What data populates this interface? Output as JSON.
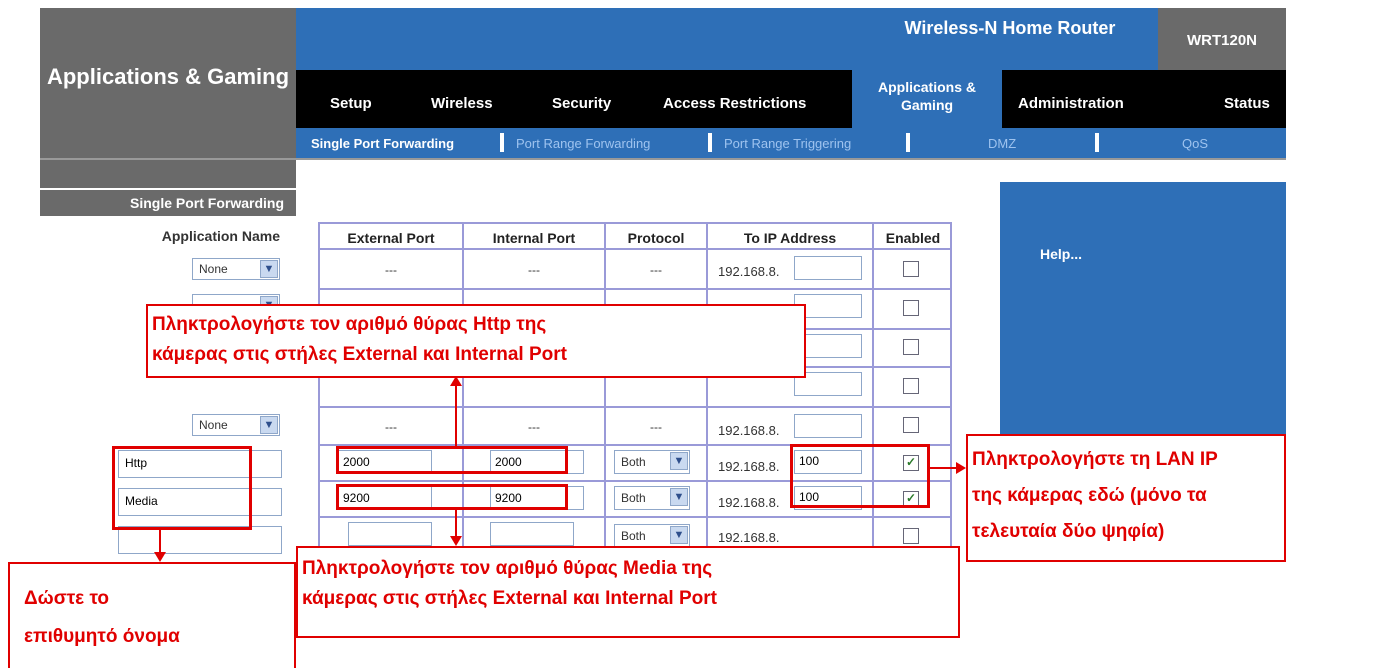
{
  "header": {
    "page_title": "Applications & Gaming",
    "product_name": "Wireless-N Home Router",
    "model": "WRT120N"
  },
  "nav": {
    "tabs": [
      "Setup",
      "Wireless",
      "Security",
      "Access Restrictions",
      "Applications & Gaming",
      "Administration",
      "Status"
    ],
    "active_tab": "Applications & Gaming"
  },
  "subnav": {
    "items": [
      "Single Port Forwarding",
      "Port Range Forwarding",
      "Port Range Triggering",
      "DMZ",
      "QoS"
    ],
    "active": "Single Port Forwarding"
  },
  "left": {
    "section_heading": "Single Port Forwarding",
    "app_name_label": "Application Name",
    "app_select_value": "None",
    "custom_names": [
      "Http",
      "Media",
      ""
    ]
  },
  "table": {
    "headers": [
      "External Port",
      "Internal Port",
      "Protocol",
      "To IP Address",
      "Enabled"
    ],
    "dash": "---",
    "ip_prefix": "192.168.8.",
    "rows": [
      {
        "external": "---",
        "internal": "---",
        "protocol": "---",
        "ip_last": "",
        "enabled": false
      },
      {
        "ip_last": "",
        "enabled": false
      },
      {
        "ip_last": "",
        "enabled": false
      },
      {
        "ip_last": "",
        "enabled": false
      },
      {
        "external": "---",
        "internal": "---",
        "protocol": "---",
        "ip_last": "",
        "enabled": false
      },
      {
        "external": "2000",
        "internal": "2000",
        "protocol": "Both",
        "ip_last": "100",
        "enabled": true
      },
      {
        "external": "9200",
        "internal": "9200",
        "protocol": "Both",
        "ip_last": "100",
        "enabled": true
      },
      {
        "external": "",
        "internal": "",
        "protocol": "Both",
        "ip_last": "",
        "enabled": false
      }
    ]
  },
  "help": {
    "link": "Help..."
  },
  "annotations": {
    "http_port_line1": "Πληκτρολογήστε τον αριθμό θύρας Http της",
    "http_port_line2": "κάμερας στις στήλες External και Internal Port",
    "media_port_line1": "Πληκτρολογήστε τον αριθμό θύρας Media της",
    "media_port_line2": "κάμερας στις στήλες External και Internal Port",
    "lan_ip_line1": "Πληκτρολογήστε τη LAN IP",
    "lan_ip_line2": "της κάμερας εδώ (μόνο τα",
    "lan_ip_line3": "τελευταία δύο ψηφία)",
    "name_line1": "Δώστε το",
    "name_line2": "επιθυμητό όνομα"
  },
  "colors": {
    "brand_blue": "#2e6fb7",
    "header_gray": "#6a6a6a",
    "annotation_red": "#e00000",
    "table_border": "#9a9ad8"
  }
}
